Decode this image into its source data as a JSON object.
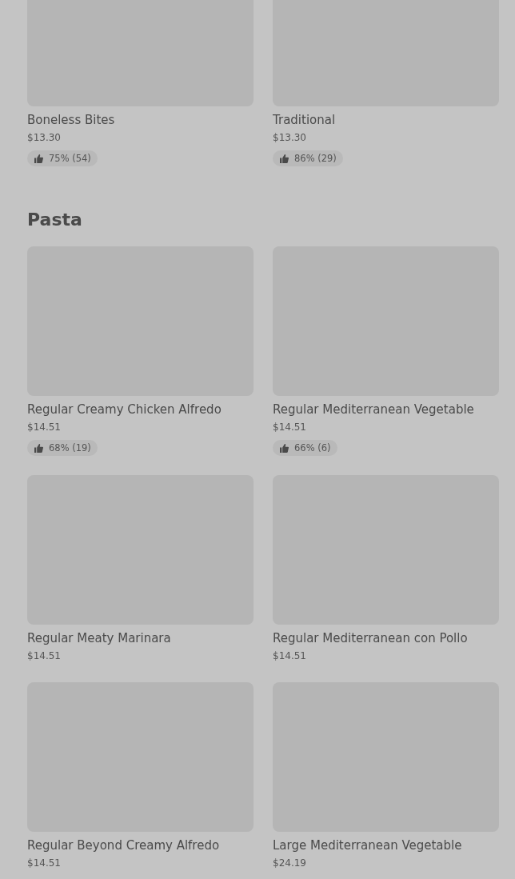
{
  "sections": [
    {
      "items": [
        {
          "name": "Boneless Bites",
          "price": "$13.30",
          "rating": "75% (54)"
        },
        {
          "name": "Traditional",
          "price": "$13.30",
          "rating": "86% (29)"
        }
      ]
    },
    {
      "heading": "Pasta",
      "items": [
        {
          "name": "Regular Creamy Chicken Alfredo",
          "price": "$14.51",
          "rating": "68% (19)"
        },
        {
          "name": "Regular Mediterranean Vegetable",
          "price": "$14.51",
          "rating": "66% (6)"
        },
        {
          "name": "Regular Meaty Marinara",
          "price": "$14.51"
        },
        {
          "name": "Regular Mediterranean con Pollo",
          "price": "$14.51"
        },
        {
          "name": "Regular Beyond Creamy Alfredo",
          "price": "$14.51"
        },
        {
          "name": "Large Mediterranean Vegetable",
          "price": "$24.19"
        }
      ]
    }
  ]
}
